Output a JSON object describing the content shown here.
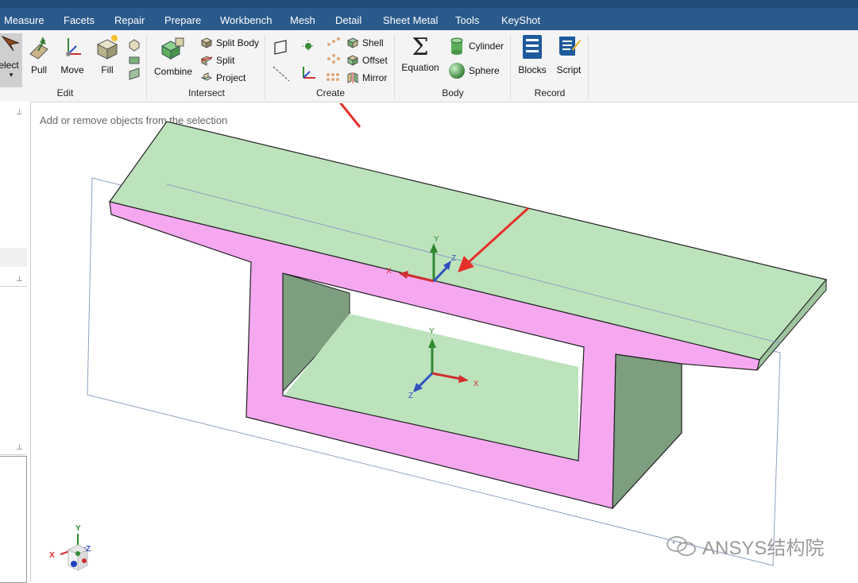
{
  "menu": [
    "Measure",
    "Facets",
    "Repair",
    "Prepare",
    "Workbench",
    "Mesh",
    "Detail",
    "Sheet Metal",
    "Tools",
    "KeyShot"
  ],
  "ribbon": {
    "select_label": "elect",
    "edit": {
      "pull": "Pull",
      "move": "Move",
      "fill": "Fill",
      "group": "Edit"
    },
    "intersect": {
      "combine": "Combine",
      "split_body": "Split Body",
      "split": "Split",
      "project": "Project",
      "group": "Intersect"
    },
    "create": {
      "shell": "Shell",
      "offset": "Offset",
      "mirror": "Mirror",
      "group": "Create"
    },
    "body": {
      "equation": "Equation",
      "cylinder": "Cylinder",
      "sphere": "Sphere",
      "group": "Body"
    },
    "record": {
      "blocks": "Blocks",
      "script": "Script",
      "group": "Record"
    }
  },
  "viewport": {
    "hint": "Add or remove objects from the selection",
    "axis_labels": {
      "x": "X",
      "y": "Y",
      "z": "Z"
    }
  },
  "watermark": "ANSYS结构院",
  "colors": {
    "menubar": "#2a5a8c",
    "top_face": "#bde3bd",
    "section_face": "#f5a8f0",
    "side_face": "#7d9e7f",
    "arrow": "#e5302a"
  }
}
